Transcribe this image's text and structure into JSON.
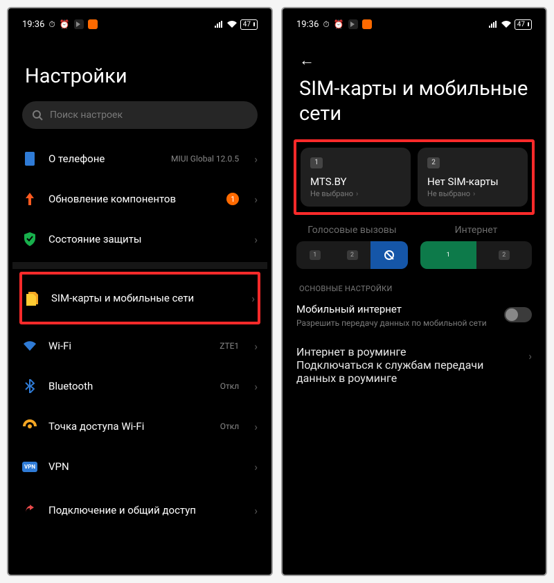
{
  "status": {
    "time": "19:36",
    "battery": "47"
  },
  "screen1": {
    "title": "Настройки",
    "search_placeholder": "Поиск настроек",
    "items": [
      {
        "key": "about",
        "label": "О телефоне",
        "meta": "MIUI Global 12.0.5"
      },
      {
        "key": "update",
        "label": "Обновление компонентов",
        "badge": "1"
      },
      {
        "key": "security",
        "label": "Состояние защиты"
      },
      {
        "key": "sim",
        "label": "SIM-карты и мобильные сети"
      },
      {
        "key": "wifi",
        "label": "Wi-Fi",
        "meta": "ZTE1"
      },
      {
        "key": "bt",
        "label": "Bluetooth",
        "meta": "Откл"
      },
      {
        "key": "hotspot",
        "label": "Точка доступа Wi-Fi",
        "meta": "Откл"
      },
      {
        "key": "vpn",
        "label": "VPN"
      },
      {
        "key": "share",
        "label": "Подключение и общий доступ"
      }
    ]
  },
  "screen2": {
    "title": "SIM-карты и мобильные сети",
    "sim1": {
      "num": "1",
      "title": "MTS.BY",
      "sub": "Не выбрано"
    },
    "sim2": {
      "num": "2",
      "title": "Нет SIM-карты",
      "sub": "Не выбрано"
    },
    "voice_label": "Голосовые вызовы",
    "internet_label": "Интернет",
    "section_header": "ОСНОВНЫЕ НАСТРОЙКИ",
    "mobnet": {
      "title": "Мобильный интернет",
      "sub": "Разрешить передачу данных по мобильной сети"
    },
    "roam": {
      "title": "Интернет в роуминге",
      "sub": "Подключаться к службам передачи данных в роуминге"
    }
  }
}
